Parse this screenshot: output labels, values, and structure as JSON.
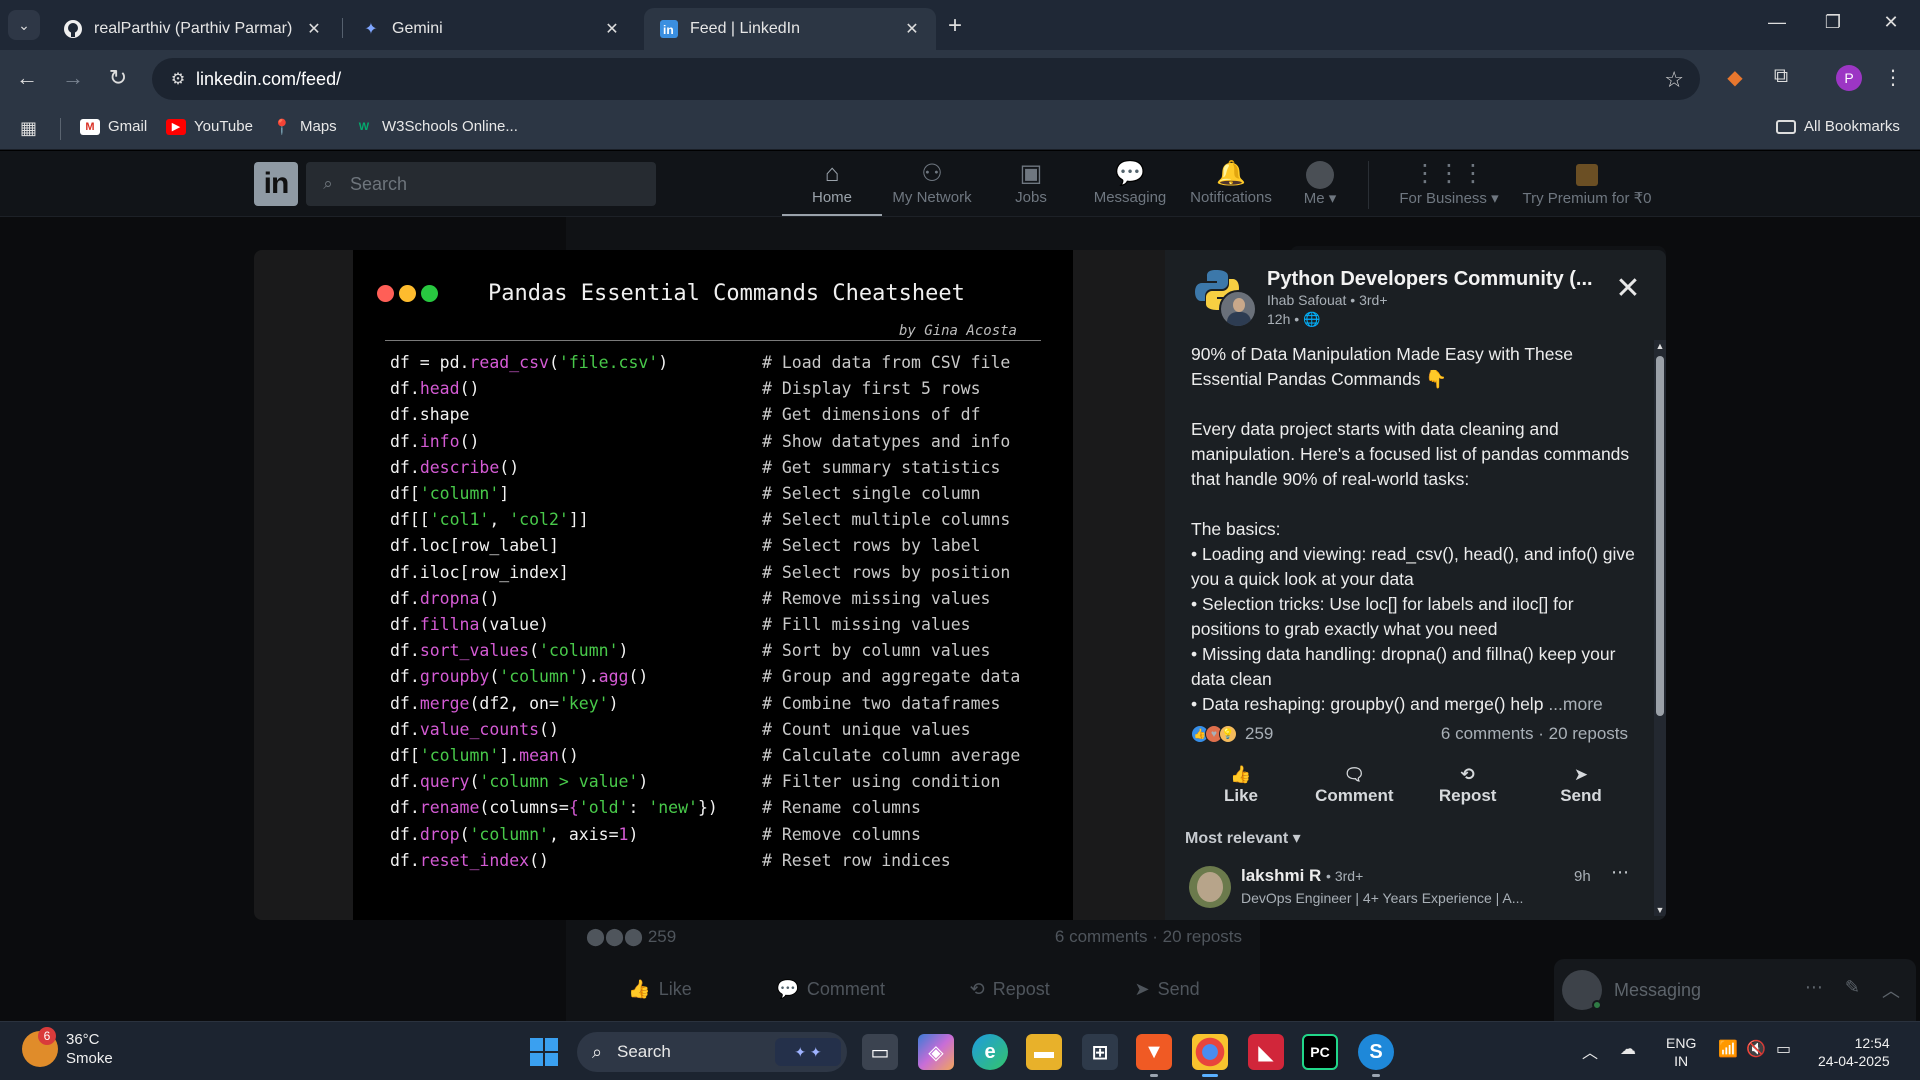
{
  "browser": {
    "tabs": [
      {
        "title": "realParthiv (Parthiv Parmar)",
        "icon": "github-icon"
      },
      {
        "title": "Gemini",
        "icon": "gemini-icon"
      },
      {
        "title": "Feed | LinkedIn",
        "icon": "linkedin-icon"
      }
    ],
    "url": "linkedin.com/feed/",
    "profile_letter": "P",
    "bookmarks": [
      "Gmail",
      "YouTube",
      "Maps",
      "W3Schools Online..."
    ],
    "all_bookmarks": "All Bookmarks"
  },
  "linkedin": {
    "logo": "in",
    "search_placeholder": "Search",
    "nav": [
      {
        "label": "Home",
        "icon": "home-icon"
      },
      {
        "label": "My Network",
        "icon": "network-icon"
      },
      {
        "label": "Jobs",
        "icon": "briefcase-icon"
      },
      {
        "label": "Messaging",
        "icon": "chat-icon"
      },
      {
        "label": "Notifications",
        "icon": "bell-icon"
      },
      {
        "label": "Me",
        "icon": "avatar-icon"
      },
      {
        "label": "For Business",
        "icon": "grid-icon"
      },
      {
        "label": "Try Premium for ₹0",
        "icon": "premium-icon"
      }
    ],
    "feed_stats": {
      "reactions": "259",
      "counts": "6 comments · 20 reposts"
    },
    "feed_actions": [
      "Like",
      "Comment",
      "Repost",
      "Send"
    ],
    "messaging": "Messaging"
  },
  "cheatsheet": {
    "title": "Pandas Essential Commands Cheatsheet",
    "author": "by Gina Acosta",
    "rows": [
      {
        "code": [
          [
            "df = pd.",
            "w"
          ],
          [
            "read_csv",
            "f"
          ],
          [
            "(",
            "w"
          ],
          [
            "'file.csv'",
            "s"
          ],
          [
            ")",
            "w"
          ]
        ],
        "comment": "# Load data from CSV file"
      },
      {
        "code": [
          [
            "df.",
            "w"
          ],
          [
            "head",
            "f"
          ],
          [
            "()",
            "w"
          ]
        ],
        "comment": "# Display first 5 rows"
      },
      {
        "code": [
          [
            "df.shape",
            "w"
          ]
        ],
        "comment": "# Get dimensions of df"
      },
      {
        "code": [
          [
            "df.",
            "w"
          ],
          [
            "info",
            "f"
          ],
          [
            "()",
            "w"
          ]
        ],
        "comment": "# Show datatypes and info"
      },
      {
        "code": [
          [
            "df.",
            "w"
          ],
          [
            "describe",
            "f"
          ],
          [
            "()",
            "w"
          ]
        ],
        "comment": "# Get summary statistics"
      },
      {
        "code": [
          [
            "df[",
            "w"
          ],
          [
            "'column'",
            "s"
          ],
          [
            "]",
            "w"
          ]
        ],
        "comment": "# Select single column"
      },
      {
        "code": [
          [
            "df[[",
            "w"
          ],
          [
            "'col1'",
            "s"
          ],
          [
            ", ",
            "w"
          ],
          [
            "'col2'",
            "s"
          ],
          [
            "]]",
            "w"
          ]
        ],
        "comment": "# Select multiple columns"
      },
      {
        "code": [
          [
            "df.loc[row_label]",
            "w"
          ]
        ],
        "comment": "# Select rows by label"
      },
      {
        "code": [
          [
            "df.iloc[row_index]",
            "w"
          ]
        ],
        "comment": "# Select rows by position"
      },
      {
        "code": [
          [
            "df.",
            "w"
          ],
          [
            "dropna",
            "f"
          ],
          [
            "()",
            "w"
          ]
        ],
        "comment": "# Remove missing values"
      },
      {
        "code": [
          [
            "df.",
            "w"
          ],
          [
            "fillna",
            "f"
          ],
          [
            "(value)",
            "w"
          ]
        ],
        "comment": "# Fill missing values"
      },
      {
        "code": [
          [
            "df.",
            "w"
          ],
          [
            "sort_values",
            "f"
          ],
          [
            "(",
            "w"
          ],
          [
            "'column'",
            "s"
          ],
          [
            ")",
            "w"
          ]
        ],
        "comment": "# Sort by column values"
      },
      {
        "code": [
          [
            "df.",
            "w"
          ],
          [
            "groupby",
            "f"
          ],
          [
            "(",
            "w"
          ],
          [
            "'column'",
            "s"
          ],
          [
            ").",
            "w"
          ],
          [
            "agg",
            "f"
          ],
          [
            "()",
            "w"
          ]
        ],
        "comment": "# Group and aggregate data"
      },
      {
        "code": [
          [
            "df.",
            "w"
          ],
          [
            "merge",
            "f"
          ],
          [
            "(df2, on=",
            "w"
          ],
          [
            "'key'",
            "s"
          ],
          [
            ")",
            "w"
          ]
        ],
        "comment": "# Combine two dataframes"
      },
      {
        "code": [
          [
            "df.",
            "w"
          ],
          [
            "value_counts",
            "f"
          ],
          [
            "()",
            "w"
          ]
        ],
        "comment": "# Count unique values"
      },
      {
        "code": [
          [
            "df[",
            "w"
          ],
          [
            "'column'",
            "s"
          ],
          [
            "].",
            "w"
          ],
          [
            "mean",
            "f"
          ],
          [
            "()",
            "w"
          ]
        ],
        "comment": "# Calculate column average"
      },
      {
        "code": [
          [
            "df.",
            "w"
          ],
          [
            "query",
            "f"
          ],
          [
            "(",
            "w"
          ],
          [
            "'column > value'",
            "s"
          ],
          [
            ")",
            "w"
          ]
        ],
        "comment": "# Filter using condition"
      },
      {
        "code": [
          [
            "df.",
            "w"
          ],
          [
            "rename",
            "f"
          ],
          [
            "(columns=",
            "w"
          ],
          [
            "{",
            "f"
          ],
          [
            "'old'",
            "s"
          ],
          [
            ": ",
            "w"
          ],
          [
            "'new'",
            "s"
          ],
          [
            "})",
            "w"
          ]
        ],
        "comment": "# Rename columns"
      },
      {
        "code": [
          [
            "df.",
            "w"
          ],
          [
            "drop",
            "f"
          ],
          [
            "(",
            "w"
          ],
          [
            "'column'",
            "s"
          ],
          [
            ", axis=",
            "w"
          ],
          [
            "1",
            "n"
          ],
          [
            ")",
            "w"
          ]
        ],
        "comment": "# Remove columns"
      },
      {
        "code": [
          [
            "df.",
            "w"
          ],
          [
            "reset_index",
            "f"
          ],
          [
            "()",
            "w"
          ]
        ],
        "comment": "# Reset row indices"
      }
    ],
    "colors": {
      "w": "#f2f2f2",
      "f": "#d45bd4",
      "s": "#48c94a",
      "n": "#d45bd4"
    },
    "dot_colors": [
      "#ff5f57",
      "#febc2e",
      "#28c840"
    ]
  },
  "post": {
    "author": "Python Developers Community (...",
    "reposter": "Ihab Safouat • 3rd+",
    "time": "12h •",
    "paragraphs": [
      "90% of Data Manipulation Made Easy with These Essential Pandas Commands 👇",
      "",
      "Every data project starts with data cleaning and manipulation. Here's a focused list of pandas commands that handle 90% of real-world tasks:",
      "",
      "The basics:",
      "• Loading and viewing: read_csv(), head(), and info() give you a quick look at your data",
      "• Selection tricks: Use loc[] for labels and iloc[] for positions to grab exactly what you need",
      "• Missing data handling: dropna() and fillna() keep your data clean"
    ],
    "last_line": "• Data reshaping: groupby() and merge() help",
    "more": "...more",
    "reactions": "259",
    "counts": "6 comments · 20 reposts",
    "actions": [
      {
        "label": "Like",
        "icon": "thumbs-up-icon"
      },
      {
        "label": "Comment",
        "icon": "comment-icon"
      },
      {
        "label": "Repost",
        "icon": "repost-icon"
      },
      {
        "label": "Send",
        "icon": "send-icon"
      }
    ],
    "sort": "Most relevant",
    "comment": {
      "name": "lakshmi R",
      "degree": "• 3rd+",
      "headline": "DevOps Engineer | 4+ Years Experience | A...",
      "time": "9h"
    }
  },
  "taskbar": {
    "weather_temp": "36°C",
    "weather_desc": "Smoke",
    "weather_badge": "6",
    "search_placeholder": "Search",
    "lang_1": "ENG",
    "lang_2": "IN",
    "time": "12:54",
    "date": "24-04-2025"
  }
}
